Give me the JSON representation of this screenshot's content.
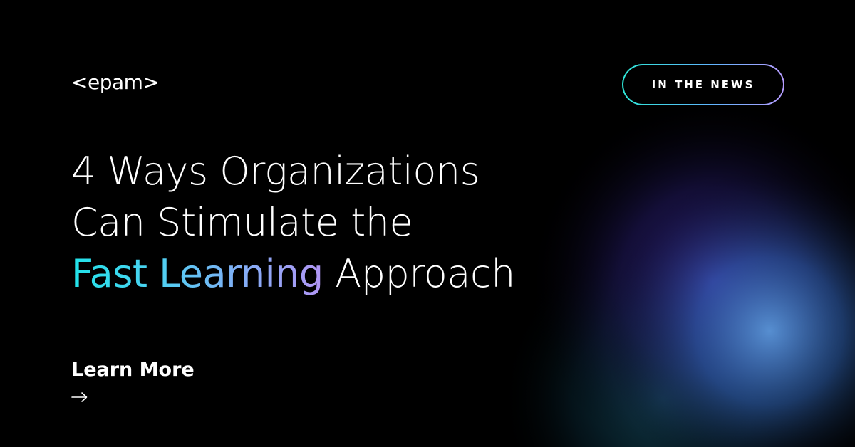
{
  "brand": {
    "logo_text": "<epam>"
  },
  "badge": {
    "label": "IN THE NEWS"
  },
  "headline": {
    "line1": "4 Ways Organizations",
    "line2": "Can Stimulate the",
    "highlight": "Fast Learning",
    "line3_rest": " Approach"
  },
  "cta": {
    "label": "Learn More",
    "icon": "arrow-right-icon"
  },
  "colors": {
    "background": "#000000",
    "text": "#ffffff",
    "accent_teal": "#21e3ea",
    "accent_violet": "#b296f5",
    "glow_blue": "#4d86d6",
    "glow_purple": "#3a2b9c"
  }
}
